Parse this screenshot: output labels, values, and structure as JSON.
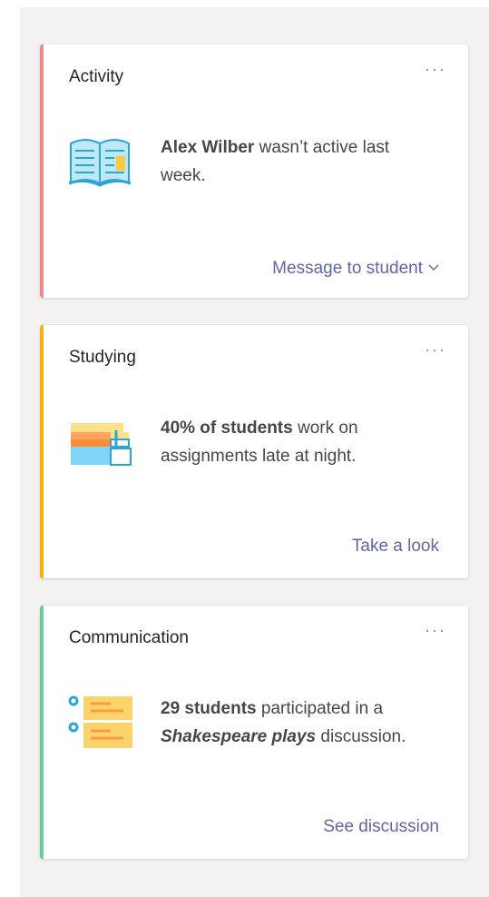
{
  "cards": [
    {
      "title": "Activity",
      "more_label": "···",
      "accent_color": "#e88d8d",
      "icon": "open-book-icon",
      "desc_bold": "Alex Wilber",
      "desc_rest": " wasn’t active last week.",
      "action_label": "Message to student",
      "action_icon": "chevron-down-icon"
    },
    {
      "title": "Studying",
      "more_label": "···",
      "accent_color": "#f2b40d",
      "icon": "stacked-books-icon",
      "desc_bold": "40% of students",
      "desc_rest": " work on assignments late at night.",
      "action_label": "Take a look"
    },
    {
      "title": "Communication",
      "more_label": "···",
      "accent_color": "#6dcb95",
      "icon": "discussion-list-icon",
      "desc_bold": "29 students",
      "desc_mid": " participated in a ",
      "desc_italic": "Shakespeare plays",
      "desc_rest": " discussion.",
      "action_label": "See discussion"
    }
  ],
  "colors": {
    "panel_bg": "#f3f2f1",
    "link": "#6264a7",
    "text": "#484644"
  }
}
